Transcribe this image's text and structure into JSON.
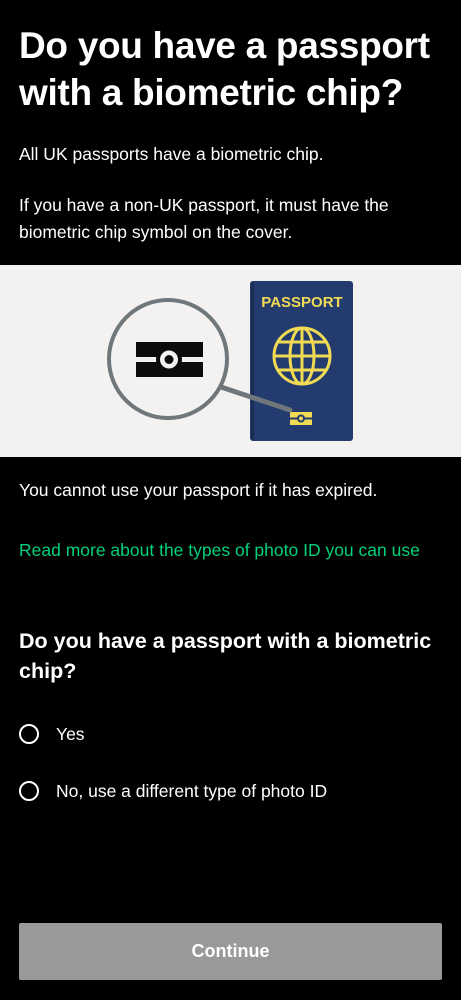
{
  "page": {
    "title": "Do you have a passport with a biometric chip?",
    "intro_paragraphs": [
      "All UK passports have a biometric chip.",
      "If you have a non-UK passport, it must have the biometric chip symbol on the cover."
    ]
  },
  "illustration": {
    "passport_label": "PASSPORT",
    "background_color": "#f3f2f1",
    "passport_color": "#233b6e",
    "emblem_color": "#f1da54",
    "icons": [
      "magnifier-icon",
      "biometric-chip-icon",
      "globe-icon"
    ]
  },
  "expired_note": "You cannot use your passport if it has expired.",
  "more_link": {
    "label": "Read more about the types of photo ID you can use",
    "color": "#00d27a"
  },
  "form": {
    "question": "Do you have a passport with a biometric chip?",
    "options": [
      {
        "label": "Yes",
        "selected": false
      },
      {
        "label": "No, use a different type of photo ID",
        "selected": false
      }
    ]
  },
  "continue_button": {
    "label": "Continue",
    "enabled": false,
    "color": "#999999"
  }
}
